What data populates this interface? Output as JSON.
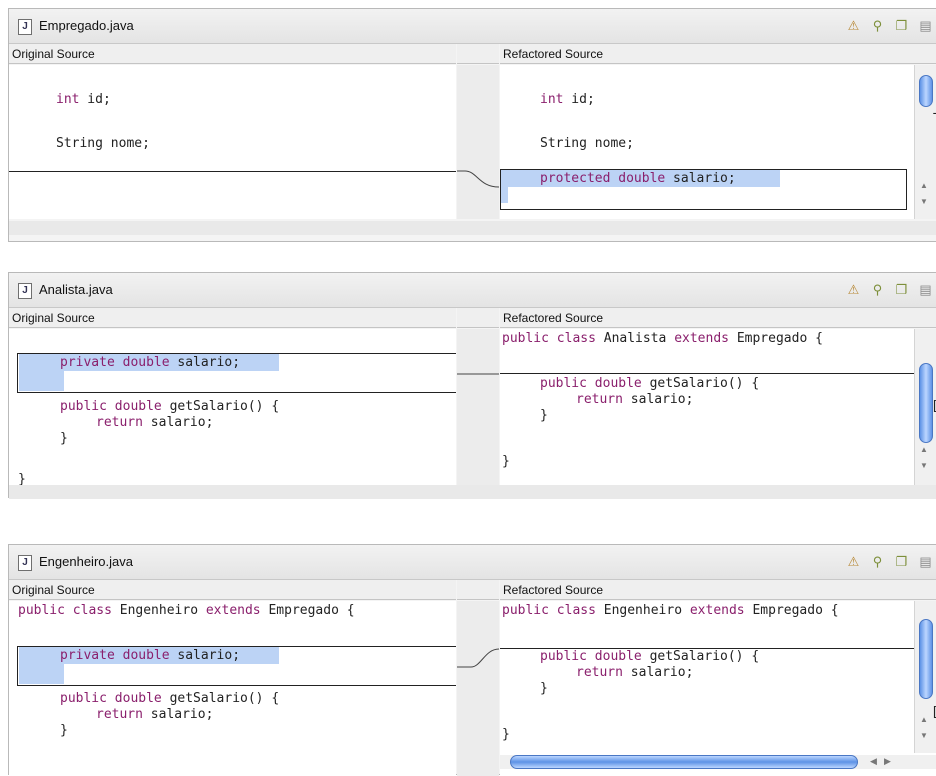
{
  "headers": {
    "original": "Original Source",
    "refactored": "Refactored Source"
  },
  "toolbar_icons": [
    "warning-triangle-icon",
    "search-icon",
    "copy-icon",
    "save-icon"
  ],
  "panels": [
    {
      "file": "Empregado.java",
      "original": [
        "int id;",
        "String nome;"
      ],
      "refactored": [
        "int id;",
        "String nome;",
        "protected double salario;"
      ]
    },
    {
      "file": "Analista.java",
      "original": [
        "private double salario;",
        "public double getSalario() {",
        "return salario;",
        "}",
        "}"
      ],
      "refactored": [
        "public class Analista extends Empregado {",
        "public double getSalario() {",
        "return salario;",
        "}",
        "}"
      ]
    },
    {
      "file": "Engenheiro.java",
      "original": [
        "public class Engenheiro extends Empregado {",
        "private double salario;",
        "public double getSalario() {",
        "return salario;",
        "}"
      ],
      "refactored": [
        "public class Engenheiro extends Empregado {",
        "public double getSalario() {",
        "return salario;",
        "}",
        "}"
      ]
    }
  ],
  "colors": {
    "keyword": "#8a1f6c",
    "highlight": "#bcd3f5",
    "scroll_thumb": "#5d92e6"
  }
}
